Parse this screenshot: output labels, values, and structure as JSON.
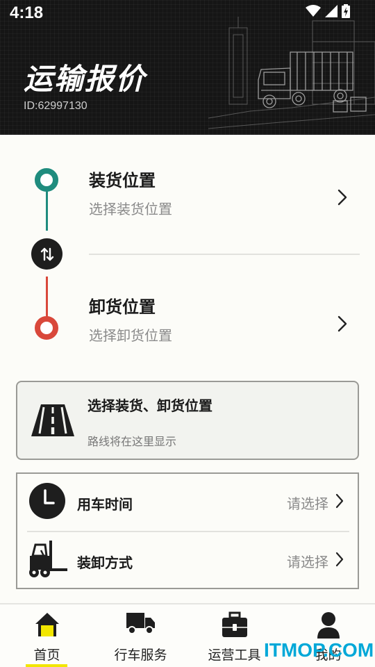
{
  "status_bar": {
    "time": "4:18"
  },
  "header": {
    "title": "运输报价",
    "id_text": "ID:62997130"
  },
  "locations": {
    "load": {
      "title": "装货位置",
      "subtitle": "选择装货位置"
    },
    "unload": {
      "title": "卸货位置",
      "subtitle": "选择卸货位置"
    }
  },
  "route": {
    "title": "选择装货、卸货位置",
    "subtitle": "路线将在这里显示"
  },
  "options": [
    {
      "label": "用车时间",
      "value": "请选择",
      "icon": "clock-icon"
    },
    {
      "label": "装卸方式",
      "value": "请选择",
      "icon": "forklift-icon"
    }
  ],
  "nav": [
    {
      "label": "首页",
      "icon": "home-icon",
      "active": true
    },
    {
      "label": "行车服务",
      "icon": "truck-icon",
      "active": false
    },
    {
      "label": "运营工具",
      "icon": "briefcase-icon",
      "active": false
    },
    {
      "label": "我的",
      "icon": "user-icon",
      "active": false
    }
  ],
  "watermark": "ITMOP.COM",
  "colors": {
    "header_bg": "#151515",
    "load_accent": "#1f8c7e",
    "unload_accent": "#d9483b",
    "nav_active": "#f2e600",
    "watermark": "#00a8d8"
  }
}
